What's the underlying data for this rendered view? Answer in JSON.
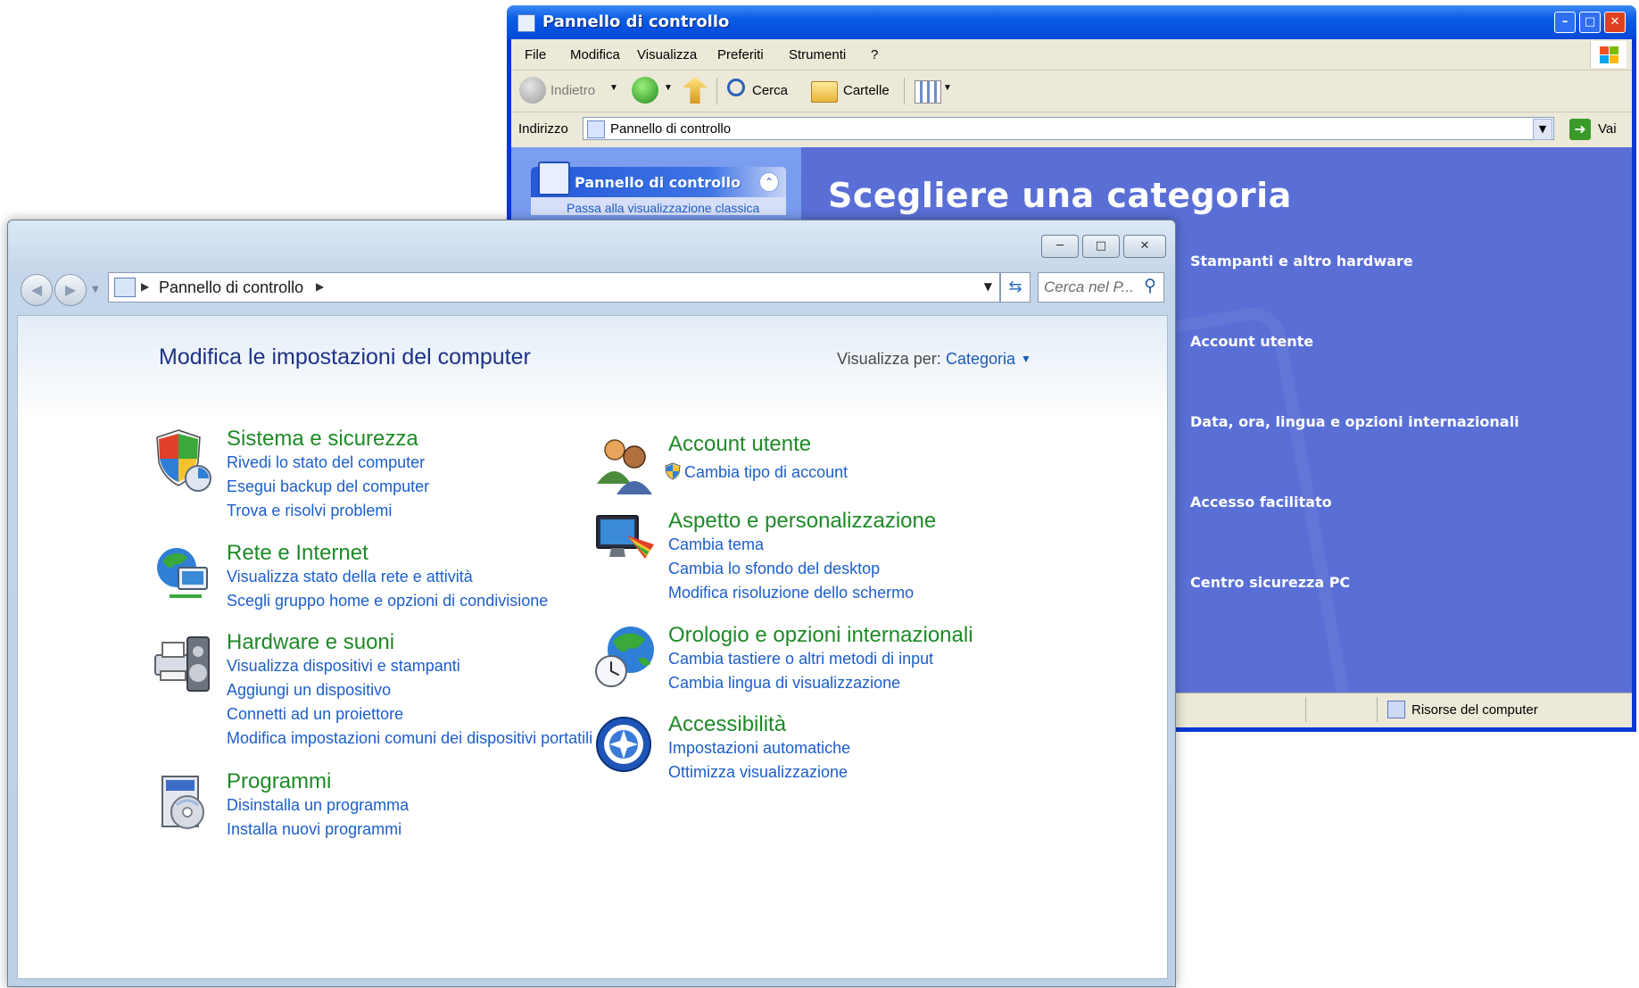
{
  "xp": {
    "title": "Pannello di controllo",
    "menu": [
      "File",
      "Modifica",
      "Visualizza",
      "Preferiti",
      "Strumenti",
      "?"
    ],
    "toolbar": {
      "back": "Indietro",
      "search": "Cerca",
      "folders": "Cartelle"
    },
    "address_label": "Indirizzo",
    "address_value": "Pannello di controllo",
    "go_label": "Vai",
    "task_title": "Pannello di controllo",
    "task_link": "Passa alla visualizzazione classica",
    "heading": "Scegliere una categoria",
    "categories": [
      {
        "label": "Stampanti e altro hardware",
        "icon": "printer-icon"
      },
      {
        "label": "Account utente",
        "icon": "users-icon"
      },
      {
        "label": "Data, ora, lingua e opzioni internazionali",
        "icon": "calendar-globe-icon"
      },
      {
        "label": "Accesso facilitato",
        "icon": "wheelchair-icon"
      },
      {
        "label": "Centro sicurezza PC",
        "icon": "shield-icon"
      }
    ],
    "status": "Risorse del computer",
    "colors": {
      "titlebar": "#0a5ce6",
      "main_bg": "#5a6fd6",
      "task_header": "#2459d8"
    }
  },
  "w7": {
    "breadcrumb": "Pannello di controllo",
    "search_placeholder": "Cerca nel P...",
    "title": "Modifica le impostazioni del computer",
    "view_by_label": "Visualizza per:",
    "view_by_value": "Categoria",
    "left": [
      {
        "title": "Sistema e sicurezza",
        "icon": "shield-security-icon",
        "links": [
          "Rivedi lo stato del computer",
          "Esegui backup del computer",
          "Trova e risolvi problemi"
        ]
      },
      {
        "title": "Rete e Internet",
        "icon": "network-globe-icon",
        "links": [
          "Visualizza stato della rete e attività",
          "Scegli gruppo home e opzioni di condivisione"
        ]
      },
      {
        "title": "Hardware e suoni",
        "icon": "printer-speaker-icon",
        "links": [
          "Visualizza dispositivi e stampanti",
          "Aggiungi un dispositivo",
          "Connetti ad un proiettore",
          "Modifica impostazioni comuni dei dispositivi portatili"
        ]
      },
      {
        "title": "Programmi",
        "icon": "programs-disc-icon",
        "links": [
          "Disinstalla un programma",
          "Installa nuovi programmi"
        ]
      }
    ],
    "right": [
      {
        "title": "Account utente",
        "icon": "users-icon",
        "links": [
          "Cambia tipo di account"
        ]
      },
      {
        "title": "Aspetto e personalizzazione",
        "icon": "monitor-paint-icon",
        "links": [
          "Cambia tema",
          "Cambia lo sfondo del desktop",
          "Modifica risoluzione dello schermo"
        ]
      },
      {
        "title": "Orologio e opzioni internazionali",
        "icon": "clock-globe-icon",
        "links": [
          "Cambia tastiere o altri metodi di input",
          "Cambia lingua di visualizzazione"
        ]
      },
      {
        "title": "Accessibilità",
        "icon": "accessibility-icon",
        "links": [
          "Impostazioni automatiche",
          "Ottimizza visualizzazione"
        ]
      }
    ],
    "colors": {
      "heading_green": "#1e8a27",
      "link_blue": "#1c5ecb",
      "title_blue": "#1e3287"
    }
  }
}
